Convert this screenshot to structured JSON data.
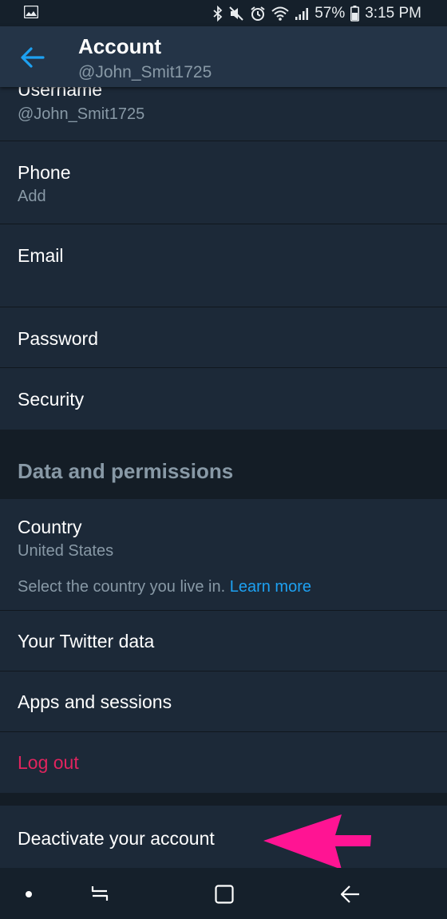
{
  "status_bar": {
    "battery": "57%",
    "time": "3:15 PM",
    "icons": [
      "image-icon",
      "bluetooth-icon",
      "mute-icon",
      "alarm-icon",
      "wifi-icon",
      "signal-icon",
      "battery-icon"
    ]
  },
  "header": {
    "title": "Account",
    "subtitle": "@John_Smit1725"
  },
  "account": {
    "username_label": "Username",
    "username_value": "@John_Smit1725",
    "phone_label": "Phone",
    "phone_value": "Add",
    "email_label": "Email",
    "password_label": "Password",
    "security_label": "Security"
  },
  "data_permissions": {
    "section_title": "Data and permissions",
    "country_label": "Country",
    "country_value": "United States",
    "country_note": "Select the country you live in.",
    "learn_more": "Learn more",
    "twitter_data_label": "Your Twitter data",
    "apps_sessions_label": "Apps and sessions",
    "logout_label": "Log out"
  },
  "deactivate": {
    "label": "Deactivate your account"
  },
  "colors": {
    "background": "#1c2938",
    "app_bar": "#243447",
    "accent": "#1da1f2",
    "logout": "#e0245e",
    "annotation_arrow": "#ff1493"
  },
  "nav_bar": {
    "icons": [
      "dot-icon",
      "recents-icon",
      "home-icon",
      "back-icon"
    ]
  }
}
